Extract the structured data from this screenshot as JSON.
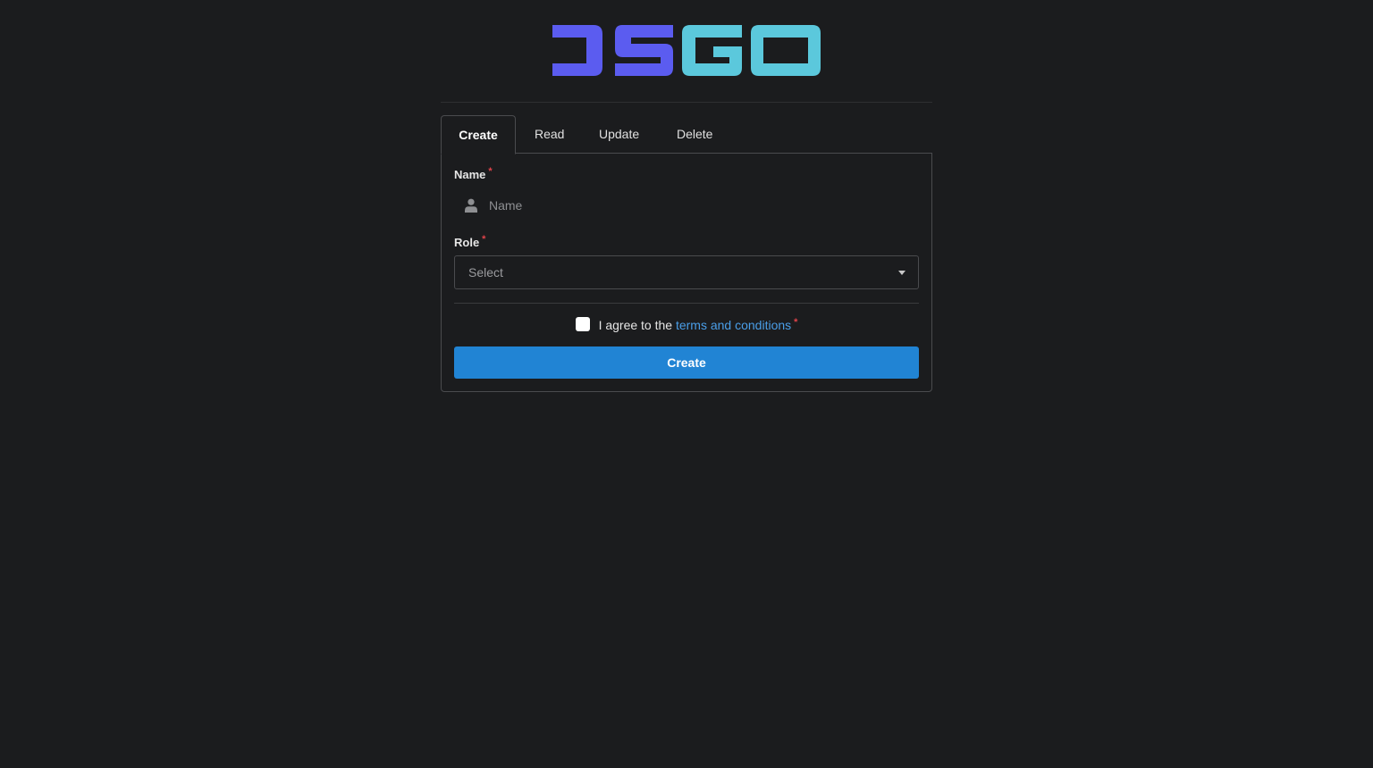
{
  "brand": {
    "logo_text": "DSGO",
    "colors": {
      "left": "#5b5cf0",
      "right": "#5bc8dc"
    }
  },
  "tabs": [
    {
      "label": "Create",
      "active": true
    },
    {
      "label": "Read",
      "active": false
    },
    {
      "label": "Update",
      "active": false
    },
    {
      "label": "Delete",
      "active": false
    }
  ],
  "form": {
    "name": {
      "label": "Name",
      "required_mark": "*",
      "placeholder": "Name",
      "value": "",
      "icon": "user-icon"
    },
    "role": {
      "label": "Role",
      "required_mark": "*",
      "selected": "Select",
      "icon": "caret-down-icon"
    },
    "agree": {
      "text_before": "I agree to the ",
      "link_text": "terms and conditions",
      "required_mark": "*",
      "checked": false
    },
    "submit_label": "Create"
  },
  "colors": {
    "background": "#1b1c1e",
    "border": "#4a4b4e",
    "primary": "#2184d4",
    "link": "#4a9ee8",
    "required": "#e0434a"
  }
}
